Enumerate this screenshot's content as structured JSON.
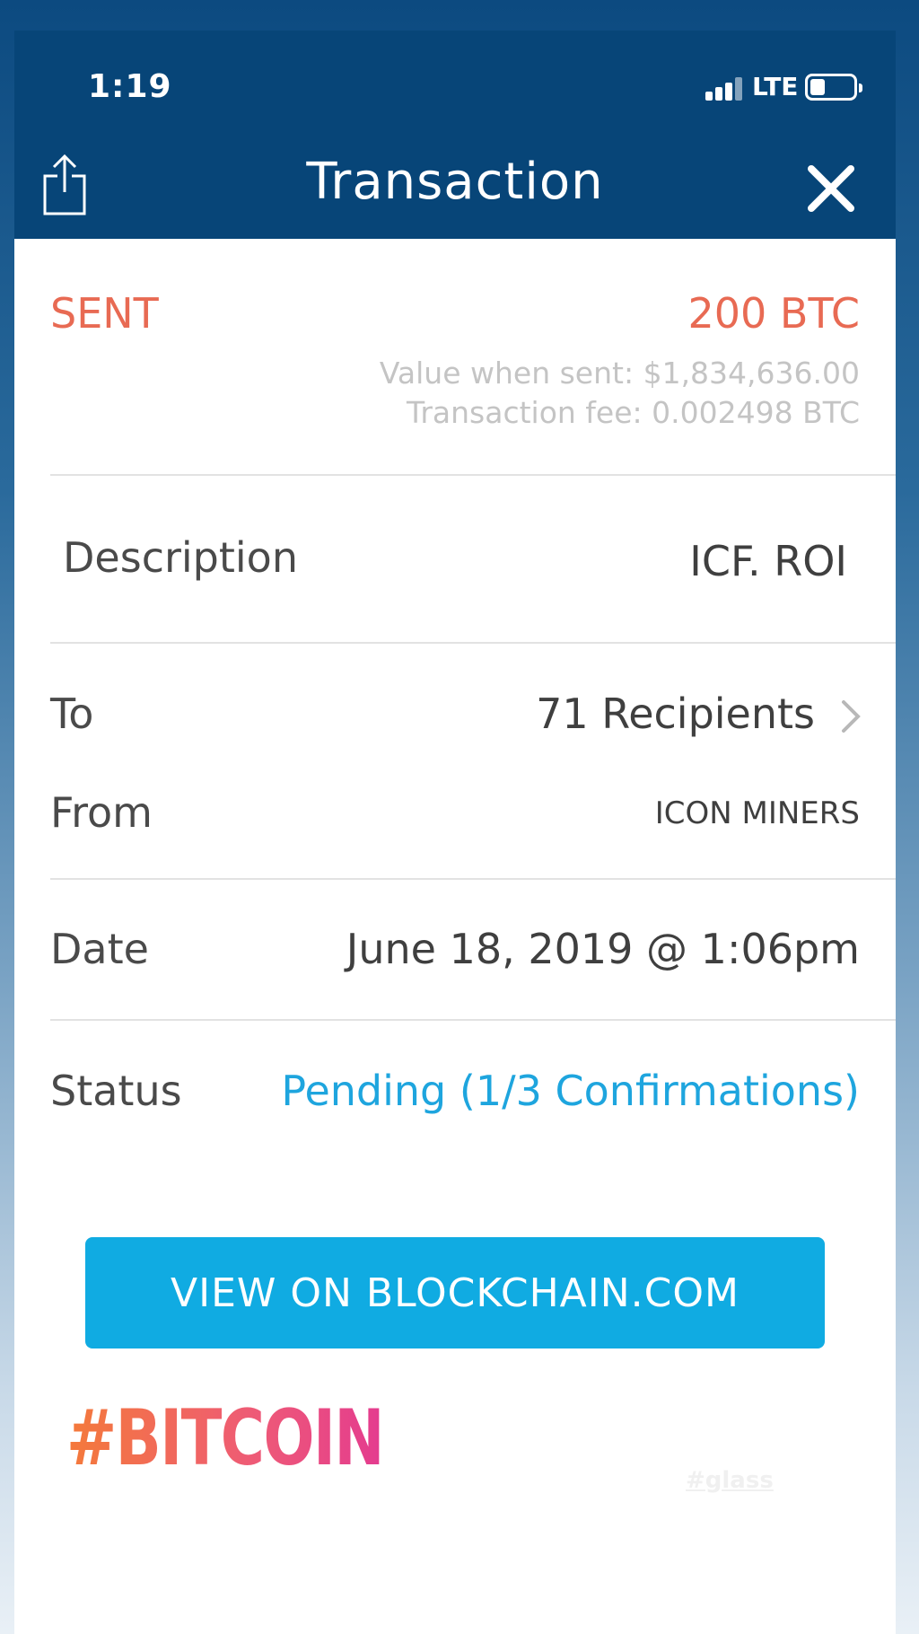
{
  "status_bar": {
    "time": "1:19",
    "network": "LTE"
  },
  "nav": {
    "title": "Transaction"
  },
  "summary": {
    "direction": "SENT",
    "amount": "200 BTC",
    "value_when_sent": "Value when sent: $1,834,636.00",
    "transaction_fee": "Transaction fee: 0.002498 BTC"
  },
  "details": {
    "description_label": "Description",
    "description_value": "ICF. ROI",
    "to_label": "To",
    "to_value": "71 Recipients",
    "from_label": "From",
    "from_value": "ICON MINERS",
    "date_label": "Date",
    "date_value": "June 18, 2019 @ 1:06pm",
    "status_label": "Status",
    "status_value": "Pending (1/3 Confirmations)"
  },
  "actions": {
    "view_blockchain_label": "VIEW ON BLOCKCHAIN.COM"
  },
  "overlay": {
    "hashtag": "#BITCOIN",
    "watermark": "#glass"
  },
  "colors": {
    "header_bg": "#074578",
    "sent_accent": "#e86a53",
    "status_accent": "#1ea5de",
    "button_bg": "#10abe2"
  },
  "icons": [
    "share-icon",
    "close-icon",
    "chevron-right-icon",
    "signal-icon",
    "battery-icon"
  ]
}
